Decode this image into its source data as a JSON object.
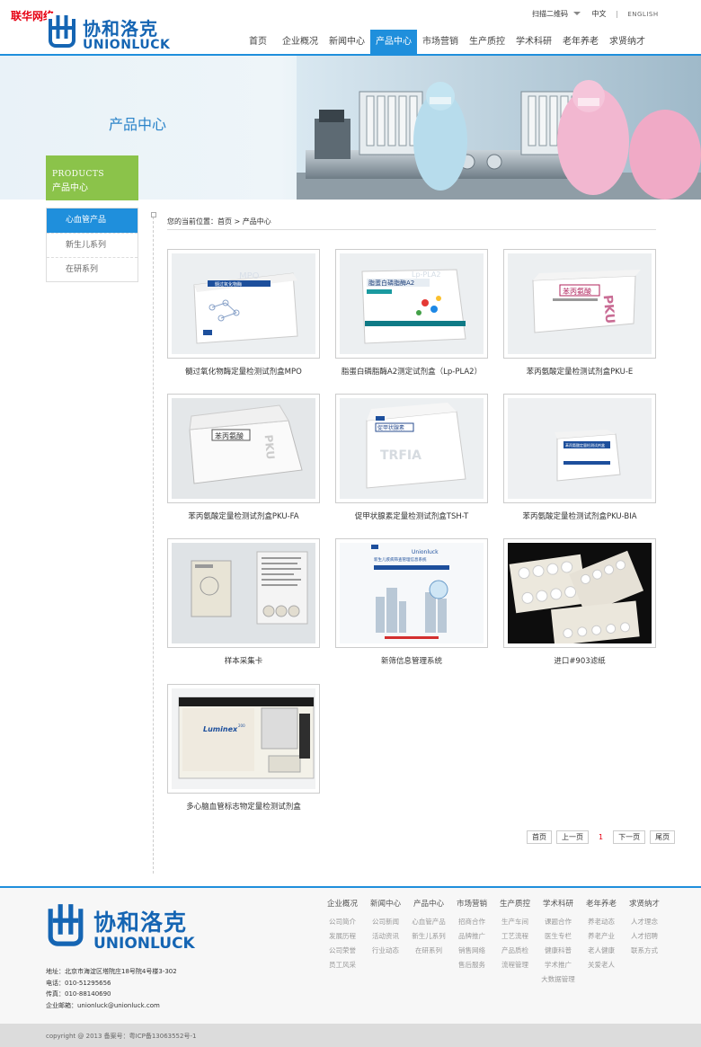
{
  "watermark": "联华网络",
  "brand": {
    "cn": "协和洛克",
    "en": "UNIONLUCK"
  },
  "toplinks": {
    "qr": "扫描二维码",
    "lang_cn": "中文",
    "lang_en": "ENGLISH"
  },
  "nav": [
    "首页",
    "企业概况",
    "新闻中心",
    "产品中心",
    "市场营销",
    "生产质控",
    "学术科研",
    "老年养老",
    "求贤纳才"
  ],
  "nav_active": "产品中心",
  "banner": {
    "title": "产品中心"
  },
  "side_head": {
    "en": "PRODUCTS",
    "cn": "产品中心"
  },
  "sidebar": [
    "心血管产品",
    "新生儿系列",
    "在研系列"
  ],
  "breadcrumb": {
    "prefix": "您的当前位置：",
    "home": "首页",
    "sep": ">",
    "current": "产品中心"
  },
  "products": [
    {
      "name": "髓过氧化物酶定量检测试剂盒MPO",
      "box_text": "髓过氧化物酶",
      "box_sub": "MPO"
    },
    {
      "name": "脂蛋白磷脂酶A2测定试剂盒（Lp-PLA2）",
      "box_text": "脂蛋白磷脂酶A2",
      "box_sub": "Lp-PLA2"
    },
    {
      "name": "苯丙氨酸定量检测试剂盒PKU-E",
      "box_text": "苯丙氨酸",
      "box_sub": "PKU"
    },
    {
      "name": "苯丙氨酸定量检测试剂盒PKU-FA",
      "box_text": "苯丙氨酸",
      "box_sub": "PKU"
    },
    {
      "name": "促甲状腺素定量检测试剂盒TSH-T",
      "box_text": "促甲状腺素",
      "box_sub": "TRFIA"
    },
    {
      "name": "苯丙氨酸定量检测试剂盒PKU-BIA",
      "box_text": "苯丙氨酸定量检测试剂盒",
      "box_sub": ""
    },
    {
      "name": "样本采集卡",
      "box_text": "",
      "box_sub": ""
    },
    {
      "name": "新筛信息管理系统",
      "box_text": "Unionluck",
      "box_sub": "新生儿疾病筛查管理信息系统"
    },
    {
      "name": "进口#903滤纸",
      "box_text": "",
      "box_sub": ""
    },
    {
      "name": "多心脑血管标志物定量检测试剂盒",
      "box_text": "Luminex",
      "box_sub": "200"
    }
  ],
  "pager": {
    "first": "首页",
    "prev": "上一页",
    "current": "1",
    "next": "下一页",
    "last": "尾页"
  },
  "footer": {
    "columns": [
      {
        "title": "企业概况",
        "links": [
          "公司简介",
          "发展历程",
          "公司荣誉",
          "员工风采"
        ]
      },
      {
        "title": "新闻中心",
        "links": [
          "公司新闻",
          "活动资讯",
          "行业动态"
        ]
      },
      {
        "title": "产品中心",
        "links": [
          "心血管产品",
          "新生儿系列",
          "在研系列"
        ]
      },
      {
        "title": "市场营销",
        "links": [
          "招商合作",
          "品牌推广",
          "销售网络",
          "售后服务"
        ]
      },
      {
        "title": "生产质控",
        "links": [
          "生产车间",
          "工艺流程",
          "产品质检",
          "流程管理"
        ]
      },
      {
        "title": "学术科研",
        "links": [
          "课题合作",
          "医生专栏",
          "健康科普",
          "学术推广",
          "大数据管理"
        ]
      },
      {
        "title": "老年养老",
        "links": [
          "养老动态",
          "养老产业",
          "老人健康",
          "关爱老人"
        ]
      },
      {
        "title": "求贤纳才",
        "links": [
          "人才理念",
          "人才招聘",
          "联系方式"
        ]
      }
    ],
    "contact": {
      "address": "地址：北京市海淀区塔院庄18号院4号楼3-302",
      "phone": "电话：010-51295656",
      "fax": "传真：010-88140690",
      "email": "企业邮箱：unionluck@unionluck.com"
    },
    "copyright": "copyright @ 2013 备案号：粤ICP备13063552号-1"
  },
  "colors": {
    "primary": "#1f8fdc",
    "brand": "#1565b3",
    "green": "#8bc34a",
    "accent_red": "#e60012"
  }
}
